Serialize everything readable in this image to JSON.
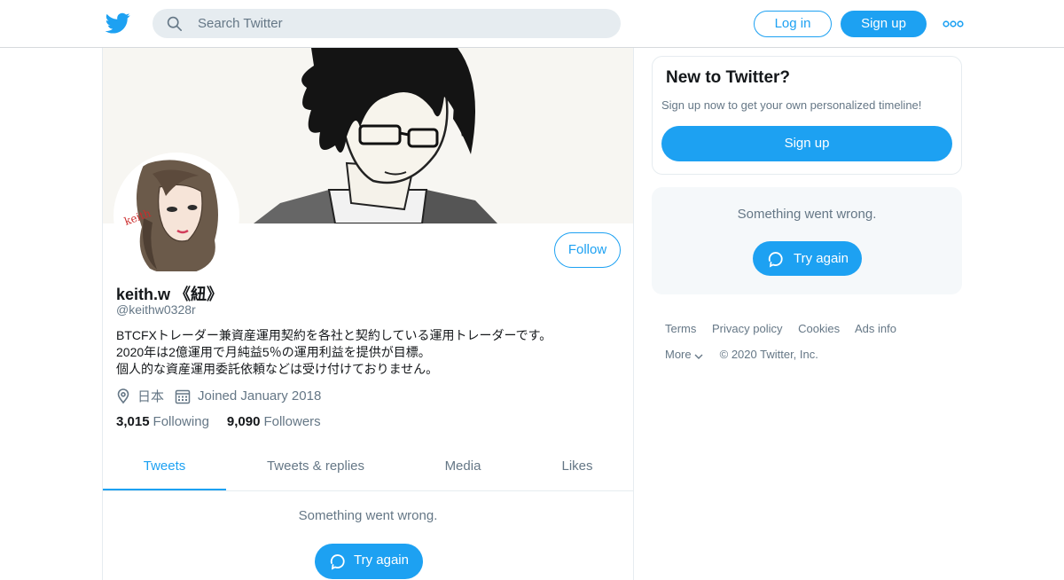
{
  "nav": {
    "logo_icon": "twitter-bird-icon",
    "search_placeholder": "Search Twitter",
    "login_label": "Log in",
    "signup_label": "Sign up",
    "more_icon": "more-dots-icon"
  },
  "profile": {
    "name": "keith.w 《紐》",
    "handle": "@keithw0328r",
    "follow_label": "Follow",
    "bio_lines": [
      "BTCFXトレーダー兼資産運用契約を各社と契約している運用トレーダーです。",
      "2020年は2億運用で月純益5％の運用利益を提供が目標。",
      "個人的な資産運用委託依頼などは受け付けておりません。"
    ],
    "location": "日本",
    "joined": "Joined January 2018",
    "following_count": "3,015",
    "following_label": "Following",
    "followers_count": "9,090",
    "followers_label": "Followers",
    "avatar_signature": "keith",
    "tabs": [
      {
        "label": "Tweets",
        "active": true
      },
      {
        "label": "Tweets & replies",
        "active": false
      },
      {
        "label": "Media",
        "active": false
      },
      {
        "label": "Likes",
        "active": false
      }
    ],
    "error_message": "Something went wrong.",
    "try_again_label": "Try again"
  },
  "sidebar": {
    "new_title": "New to Twitter?",
    "new_subtitle": "Sign up now to get your own personalized timeline!",
    "signup_label": "Sign up",
    "error_message": "Something went wrong.",
    "try_again_label": "Try again"
  },
  "footer": {
    "links": [
      "Terms",
      "Privacy policy",
      "Cookies",
      "Ads info"
    ],
    "more_label": "More",
    "copyright": "© 2020 Twitter, Inc."
  },
  "colors": {
    "accent": "#1da1f2",
    "muted_text": "#657786",
    "border": "#e6ecf0"
  }
}
